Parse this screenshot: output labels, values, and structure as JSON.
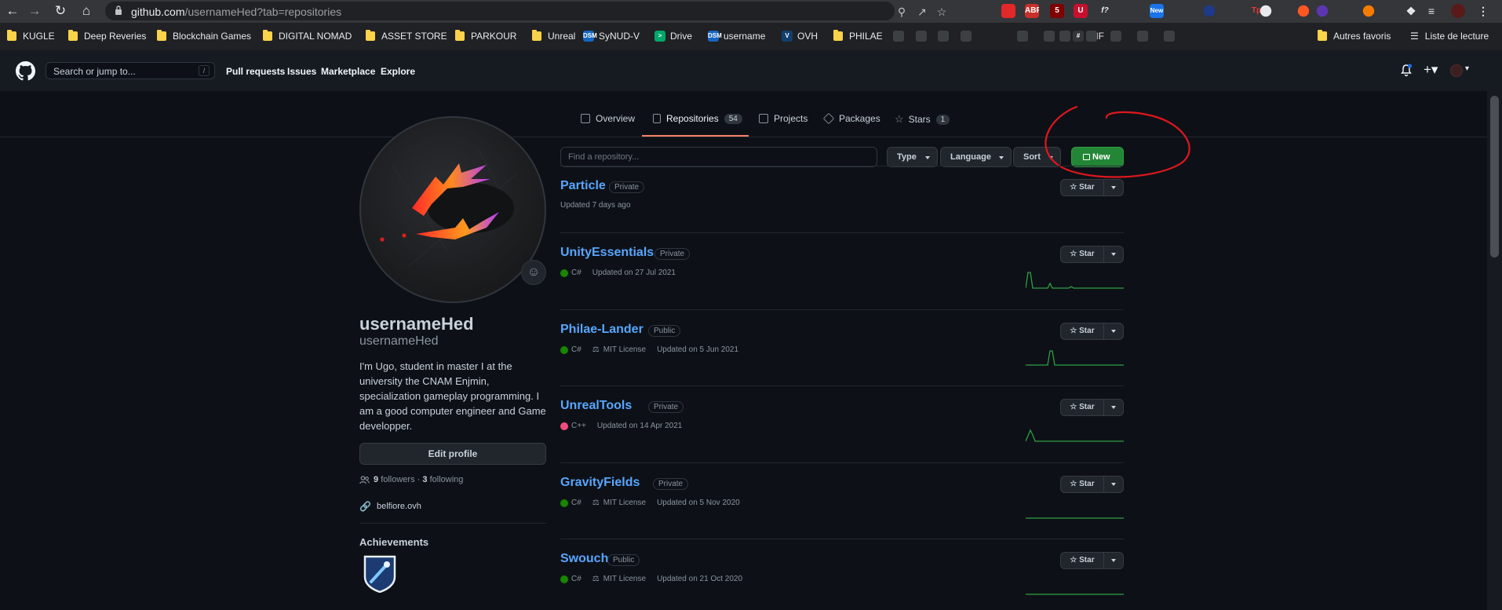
{
  "browser": {
    "url_host": "github.com",
    "url_path": "/usernameHed?tab=repositories",
    "extensions": [
      {
        "icon": "pdf-ext-icon",
        "color": "#e22828",
        "text": ""
      },
      {
        "icon": "abp-ext-icon",
        "color": "#c7302a",
        "text": "ABP"
      },
      {
        "icon": "ublock-ext-icon",
        "color": "#800000",
        "text": "5"
      },
      {
        "icon": "u-ext-icon",
        "color": "#c8102e",
        "text": "U"
      },
      {
        "icon": "fx-ext-icon",
        "color": "#35363a",
        "text": "f?"
      },
      {
        "icon": "new-ext-icon",
        "color": "#1a73e8",
        "text": "New"
      },
      {
        "icon": "tp-ext-icon",
        "color": "#35363a",
        "text": "Tp"
      }
    ],
    "bookmarks": [
      {
        "type": "folder",
        "label": "KUGLE"
      },
      {
        "type": "folder",
        "label": "Deep Reveries"
      },
      {
        "type": "folder",
        "label": "Blockchain Games"
      },
      {
        "type": "folder",
        "label": "DIGITAL NOMAD"
      },
      {
        "type": "folder",
        "label": "ASSET STORE"
      },
      {
        "type": "folder",
        "label": "PARKOUR"
      },
      {
        "type": "folder",
        "label": "Unreal"
      },
      {
        "type": "site",
        "label": "SyNUD-V",
        "icon_color": "#1565c0",
        "icon_text": "DSM"
      },
      {
        "type": "site",
        "label": "Drive",
        "icon_color": "#00a86b",
        "icon_text": ">"
      },
      {
        "type": "site",
        "label": "username",
        "icon_color": "#1565c0",
        "icon_text": "DSM"
      },
      {
        "type": "site",
        "label": "OVH",
        "icon_color": "#123f6d",
        "icon_text": "V"
      },
      {
        "type": "folder",
        "label": "PHILAE"
      },
      {
        "type": "site",
        "label": "GIF",
        "icon_color": "#35363a",
        "icon_text": "#"
      }
    ],
    "bookmarks_right": [
      {
        "type": "folder",
        "label": "Autres favoris"
      },
      {
        "type": "list",
        "label": "Liste de lecture"
      }
    ]
  },
  "gh_header": {
    "search_placeholder": "Search or jump to...",
    "search_shortcut": "/",
    "nav": [
      "Pull requests",
      "Issues",
      "Marketplace",
      "Explore"
    ]
  },
  "tabs": [
    {
      "label": "Overview",
      "icon": "book-icon"
    },
    {
      "label": "Repositories",
      "count": "54",
      "icon": "repo-icon",
      "active": true
    },
    {
      "label": "Projects",
      "icon": "table-icon"
    },
    {
      "label": "Packages",
      "icon": "package-icon"
    },
    {
      "label": "Stars",
      "count": "1",
      "icon": "star-icon"
    }
  ],
  "profile": {
    "fullname": "usernameHed",
    "login": "usernameHed",
    "bio": "I'm Ugo, student in master I at the university the CNAM Enjmin, specialization gameplay programming. I am a good computer engineer and Game developper.",
    "edit_label": "Edit profile",
    "followers": "9",
    "followers_label": "followers",
    "following": "3",
    "following_label": "following",
    "separator": "·",
    "website": "belfiore.ovh",
    "achievements_label": "Achievements"
  },
  "repo_filters": {
    "search_placeholder": "Find a repository...",
    "type_label": "Type",
    "language_label": "Language",
    "sort_label": "Sort",
    "new_label": "New"
  },
  "colors": {
    "csharp": "#178600",
    "cpp": "#f34b7d",
    "link": "#58a6ff",
    "new_button": "#238636",
    "annotation": "#e0161e"
  },
  "repos": [
    {
      "name": "Particle",
      "visibility": "Private",
      "language": "",
      "license": "",
      "updated": "Updated 7 days ago",
      "sparkline": false
    },
    {
      "name": "UnityEssentials",
      "visibility": "Private",
      "language": "C#",
      "license": "",
      "updated": "Updated on 27 Jul 2021",
      "sparkline": true
    },
    {
      "name": "Philae-Lander",
      "visibility": "Public",
      "language": "C#",
      "license": "MIT License",
      "updated": "Updated on 5 Jun 2021",
      "sparkline": true
    },
    {
      "name": "UnrealTools",
      "visibility": "Private",
      "language": "C++",
      "license": "",
      "updated": "Updated on 14 Apr 2021",
      "sparkline": true
    },
    {
      "name": "GravityFields",
      "visibility": "Private",
      "language": "C#",
      "license": "MIT License",
      "updated": "Updated on 5 Nov 2020",
      "sparkline": true
    },
    {
      "name": "Swouch",
      "visibility": "Public",
      "language": "C#",
      "license": "MIT License",
      "updated": "Updated on 21 Oct 2020",
      "sparkline": true
    }
  ],
  "star_label": "Star"
}
